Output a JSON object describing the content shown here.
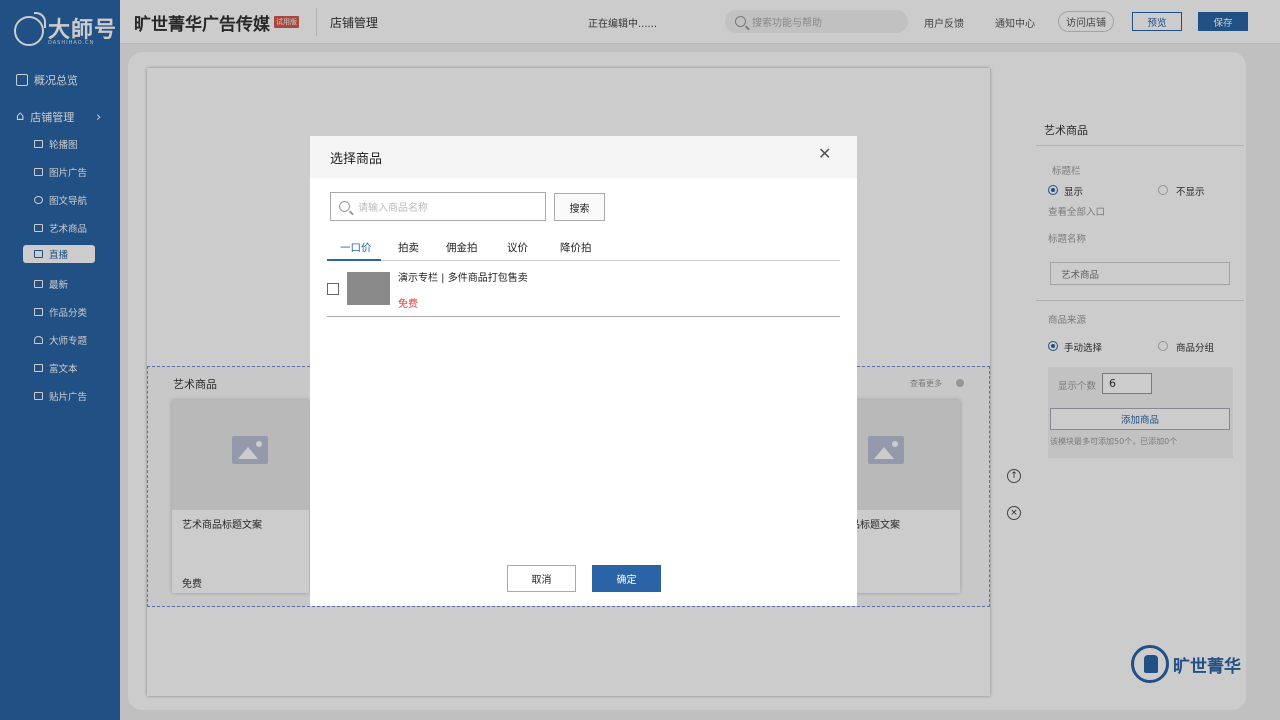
{
  "sidebar": {
    "logo_text": "大師号",
    "logo_sub": "DASHIHAO.CN",
    "overview": "概况总览",
    "store_manage": "店铺管理",
    "items": [
      {
        "label": "轮播图"
      },
      {
        "label": "图片广告"
      },
      {
        "label": "图文导航"
      },
      {
        "label": "艺术商品"
      },
      {
        "label": "直播"
      },
      {
        "label": "最新"
      },
      {
        "label": "作品分类"
      },
      {
        "label": "大师专题"
      },
      {
        "label": "富文本"
      },
      {
        "label": "贴片广告"
      }
    ],
    "active_index": 4
  },
  "topbar": {
    "brand": "旷世菁华广告传媒",
    "badge": "试用版",
    "section": "店铺管理",
    "editing": "正在编辑中......",
    "search_placeholder": "搜索功能与帮助",
    "feedback": "用户反馈",
    "notify": "通知中心",
    "visit": "访问店铺",
    "preview": "预览",
    "save": "保存"
  },
  "canvas": {
    "module_title": "艺术商品",
    "more": "查看更多",
    "cards": [
      {
        "title": "艺术商品标题文案",
        "price": "免费"
      },
      {
        "title": "品标题文案",
        "price": ""
      }
    ],
    "up_icon": "↑",
    "close_icon": "×"
  },
  "panel": {
    "title": "艺术商品",
    "title_bar_label": "标题栏",
    "show": "显示",
    "hide": "不显示",
    "view_all": "查看全部入口",
    "title_name_label": "标题名称",
    "title_name_value": "艺术商品",
    "source_label": "商品来源",
    "manual": "手动选择",
    "group": "商品分组",
    "count_label": "显示个数",
    "count_value": "6",
    "add_button": "添加商品",
    "hint": "该模块最多可添加50个，已添加0个",
    "corner_text": "旷世菁华"
  },
  "modal": {
    "title": "选择商品",
    "search_placeholder": "请输入商品名称",
    "search_button": "搜索",
    "tabs": [
      "一口价",
      "拍卖",
      "佣金拍",
      "议价",
      "降价拍"
    ],
    "active_tab": 0,
    "product": {
      "name": "演示专栏 | 多件商品打包售卖",
      "price": "免费"
    },
    "cancel": "取消",
    "confirm": "确定"
  },
  "colors": {
    "primary": "#2a64a6",
    "price_red": "#e23b2e",
    "badge_red": "#d8574a"
  }
}
